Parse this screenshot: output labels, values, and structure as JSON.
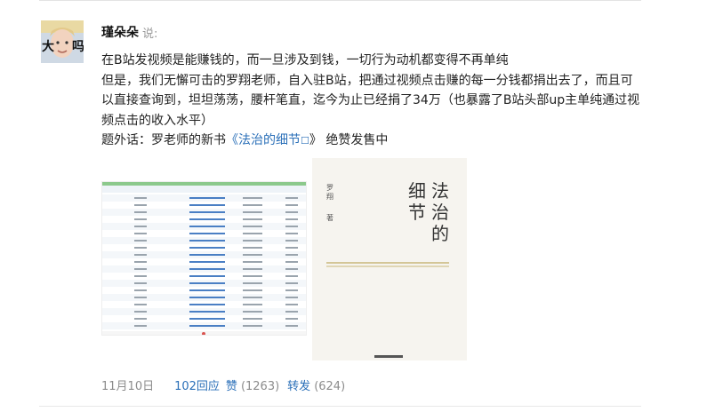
{
  "post": {
    "author": "瑾朵朵",
    "said": "说:",
    "lines": [
      "在B站发视频是能赚钱的，而一旦涉及到钱，一切行为动机都变得不再单纯",
      "但是，我们无懈可击的罗翔老师，自入驻B站，把通过视频点击赚的每一分钱都捐出去了，而且可以直接查询到，坦坦荡荡，腰杆笔直，迄今为止已经捐了34万（也暴露了B站头部up主单纯通过视频点击的收入水平）"
    ],
    "aside_prefix": "题外话：罗老师的新书",
    "aside_book": "《法治的细节",
    "aside_book_icon": "book-icon",
    "aside_suffix": "》 绝赞发售中"
  },
  "book_cover": {
    "title_chars_col1": "法治的",
    "title_chars_col2": "细节",
    "author": "罗翔",
    "author_suffix": "著"
  },
  "meta": {
    "date": "11月10日",
    "replies": "102回应",
    "likes_label": "赞",
    "likes_count": "(1263)",
    "shares_label": "转发",
    "shares_count": "(624)"
  },
  "colors": {
    "link": "#2a6fb8",
    "meta": "#8c8c8c"
  }
}
